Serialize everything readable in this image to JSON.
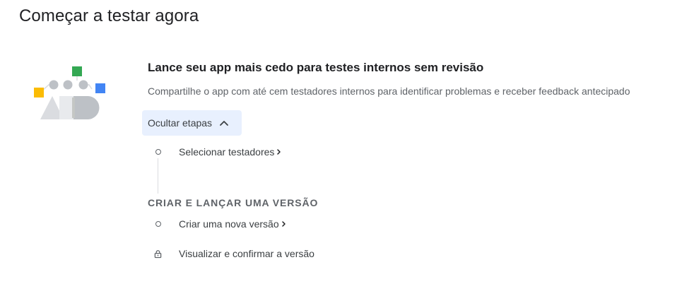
{
  "page": {
    "title": "Começar a testar agora"
  },
  "card": {
    "title": "Lance seu app mais cedo para testes internos sem revisão",
    "subtitle": "Compartilhe o app com até cem testadores internos para identificar problemas e receber feedback antecipado",
    "toggle_label": "Ocultar etapas",
    "toggle_icon": "chevron-up-icon"
  },
  "steps": [
    {
      "label": "Selecionar testadores",
      "icon": "circle-step-icon",
      "link": true
    },
    {
      "label": "Criar uma nova versão",
      "icon": "circle-step-icon",
      "link": true
    },
    {
      "label": "Visualizar e confirmar a versão",
      "icon": "lock-icon",
      "link": false
    }
  ],
  "section": {
    "title": "CRIAR E LANÇAR UMA VERSÃO"
  },
  "colors": {
    "accent_bg": "#e8f0fe",
    "green": "#34a853",
    "yellow": "#fbbc04",
    "blue": "#4285f4",
    "gray": "#dadce0"
  }
}
